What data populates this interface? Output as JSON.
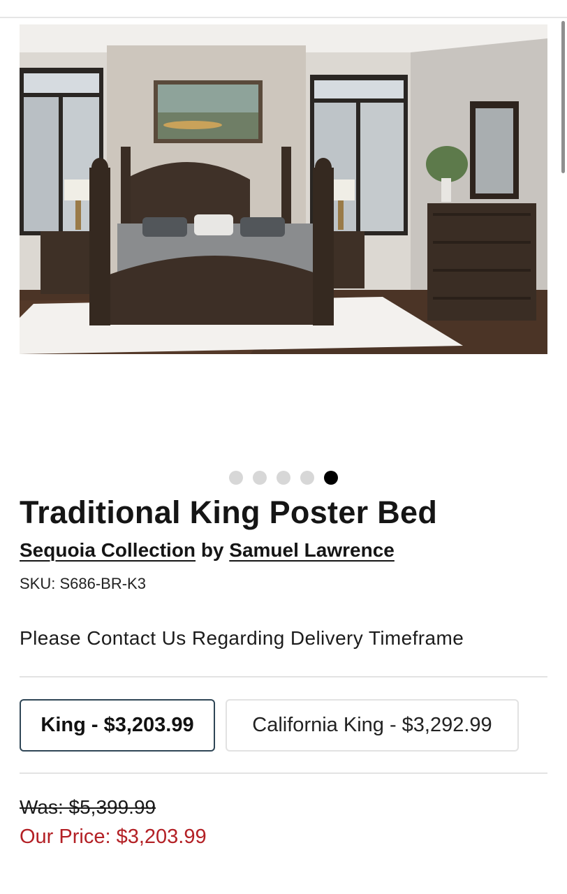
{
  "product": {
    "title": "Traditional King Poster Bed",
    "collection_link": "Sequoia Collection",
    "by_text": "by",
    "brand_link": "Samuel Lawrence",
    "sku": "SKU: S686-BR-K3",
    "delivery_note": "Please Contact Us Regarding Delivery Timeframe"
  },
  "carousel": {
    "total_images": 5,
    "active_index": 4
  },
  "size_options": [
    {
      "label": "King - $3,203.99",
      "selected": true
    },
    {
      "label": "California King - $3,292.99",
      "selected": false
    }
  ],
  "pricing": {
    "was": "Was: $5,399.99",
    "our_price": "Our Price: $3,203.99"
  },
  "colors": {
    "accent_border": "#2f4656",
    "price_red": "#b32025",
    "active_dot": "#000000",
    "inactive_dot": "#d7d7d7"
  }
}
